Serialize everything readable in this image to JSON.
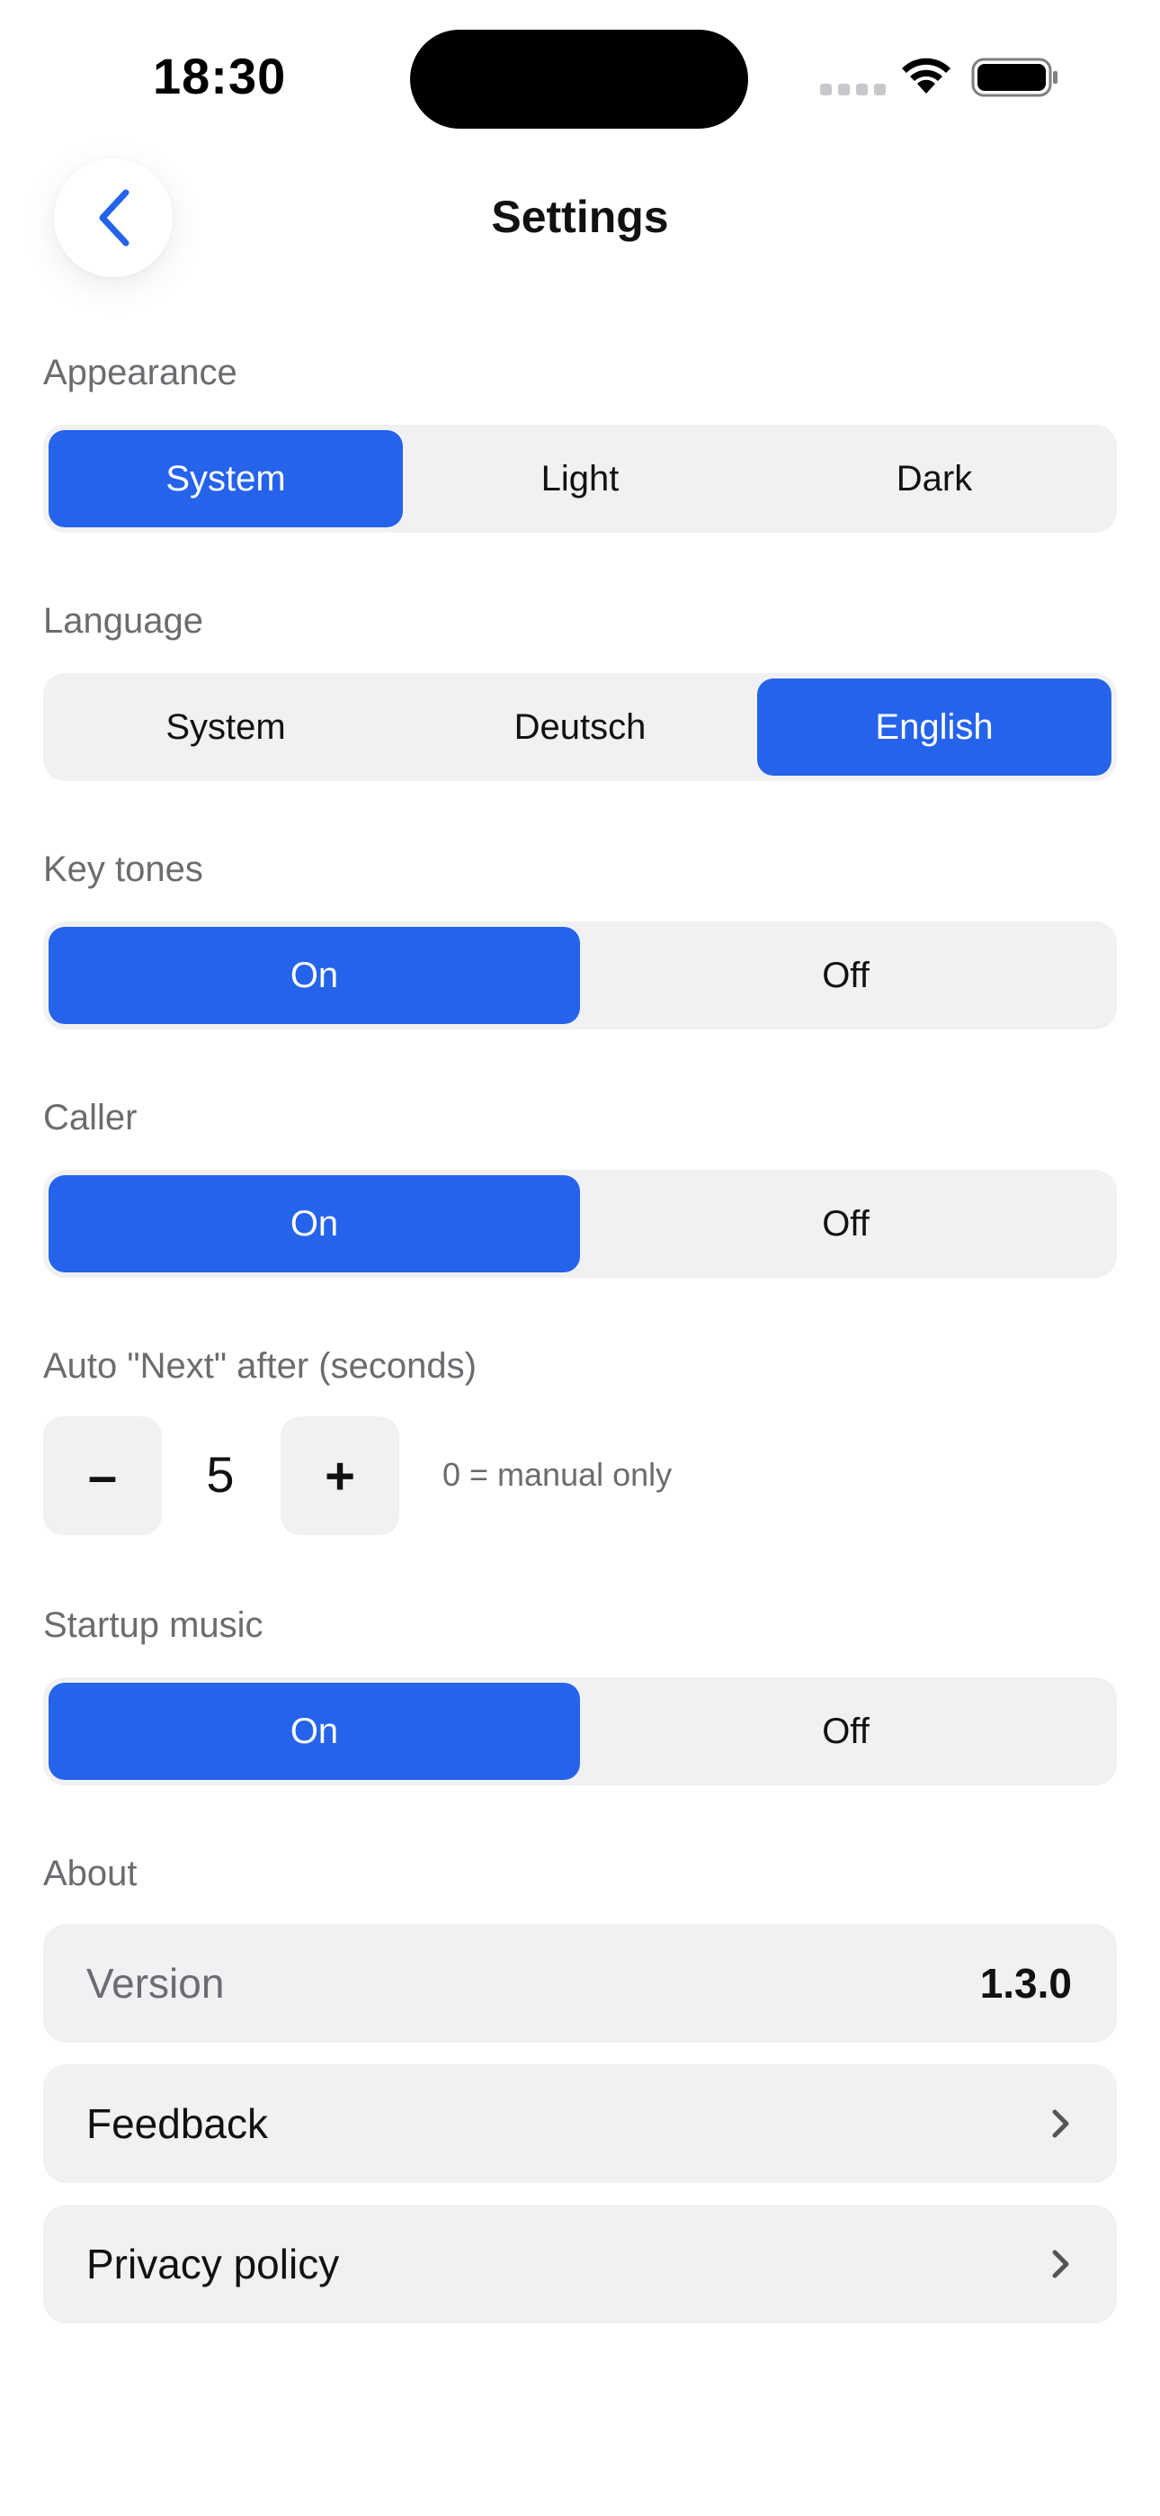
{
  "status_bar": {
    "time": "18:30"
  },
  "nav": {
    "title": "Settings",
    "back_icon": "chevron-left-icon"
  },
  "colors": {
    "accent": "#2563eb",
    "segment_bg": "#f1f1f3",
    "label_gray": "#6b6b70"
  },
  "appearance": {
    "label": "Appearance",
    "options": [
      "System",
      "Light",
      "Dark"
    ],
    "selected": "System"
  },
  "language": {
    "label": "Language",
    "options": [
      "System",
      "Deutsch",
      "English"
    ],
    "selected": "English"
  },
  "key_tones": {
    "label": "Key tones",
    "options": [
      "On",
      "Off"
    ],
    "selected": "On"
  },
  "caller": {
    "label": "Caller",
    "options": [
      "On",
      "Off"
    ],
    "selected": "On"
  },
  "auto_next": {
    "label": "Auto \"Next\" after (seconds)",
    "minus": "–",
    "value": "5",
    "plus": "+",
    "hint": "0 = manual only"
  },
  "startup_music": {
    "label": "Startup music",
    "options": [
      "On",
      "Off"
    ],
    "selected": "On"
  },
  "about": {
    "label": "About",
    "version_label": "Version",
    "version_value": "1.3.0",
    "feedback_label": "Feedback",
    "privacy_label": "Privacy policy",
    "row_icon": "chevron-right-icon"
  }
}
